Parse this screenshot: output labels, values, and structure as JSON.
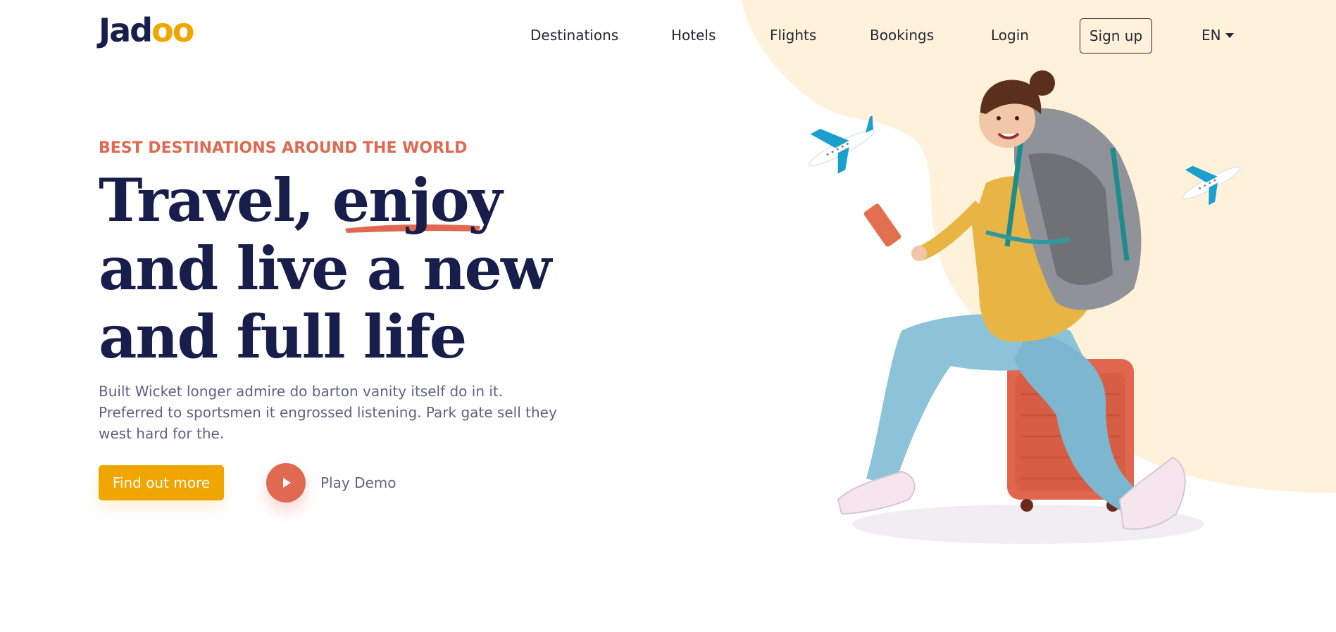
{
  "brand": {
    "logo_main": "Jad",
    "logo_accent": "oo"
  },
  "nav": {
    "links": [
      "Destinations",
      "Hotels",
      "Flights",
      "Bookings",
      "Login"
    ],
    "signup_label": "Sign up",
    "language": "EN"
  },
  "hero": {
    "eyebrow": "BEST DESTINATIONS AROUND THE WORLD",
    "headline_line1_a": "Travel, ",
    "headline_line1_b": "enjoy",
    "headline_line2": "and live a new",
    "headline_line3": "and full life",
    "description": "Built Wicket longer admire do barton vanity itself do in it. Preferred to sportsmen it engrossed listening. Park gate sell they west hard for the.",
    "primary_cta": "Find out more",
    "secondary_cta": "Play Demo"
  },
  "colors": {
    "brand_navy": "#181e4b",
    "accent_orange": "#df6951",
    "accent_yellow": "#f1a501",
    "blob_cream": "#fff1da",
    "body_gray": "#5e6282"
  },
  "icons": {
    "play": "play-icon",
    "language_caret": "chevron-down-icon",
    "illustration": "traveler-illustration",
    "planes": "airplane-icon"
  }
}
